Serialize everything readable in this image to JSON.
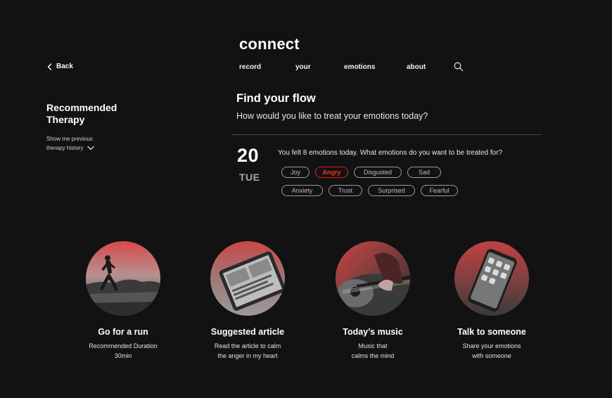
{
  "header": {
    "brand": "connect",
    "nav": [
      "record",
      "your",
      "emotions",
      "about"
    ],
    "back_label": "Back"
  },
  "sidebar": {
    "title_line1": "Recommended",
    "title_line2": "Therapy",
    "history_line1": "Show me previous",
    "history_line2": "therapy history"
  },
  "main": {
    "title": "Find your flow",
    "subtitle": "How would you like to treat your emotions today?",
    "date_number": "20",
    "date_day": "TUE",
    "question": "You felt 8 emotions today. What emotions do you want to be treated for?",
    "chips_row1": [
      "Joy",
      "Angry",
      "Disgusted",
      "Sad"
    ],
    "chips_row2": [
      "Anxiety",
      "Trust",
      "Surprised",
      "Fearful"
    ],
    "selected_chip": "Angry"
  },
  "cards": [
    {
      "title": "Go for a run",
      "desc1": "Recommended Duration",
      "desc2": "30min"
    },
    {
      "title": "Suggested article",
      "desc1": "Read the article to calm",
      "desc2": "the anger in my heart"
    },
    {
      "title": "Today’s music",
      "desc1": "Music that",
      "desc2": "calms the mind"
    },
    {
      "title": "Talk to someone",
      "desc1": "Share your emotions",
      "desc2": "with someone"
    }
  ],
  "colors": {
    "background": "#121212",
    "accent": "#e0201b",
    "chip_border": "#9a9a9a"
  },
  "icons": {
    "back": "chevron-left-icon",
    "search": "search-icon",
    "history": "chevron-down-icon"
  }
}
